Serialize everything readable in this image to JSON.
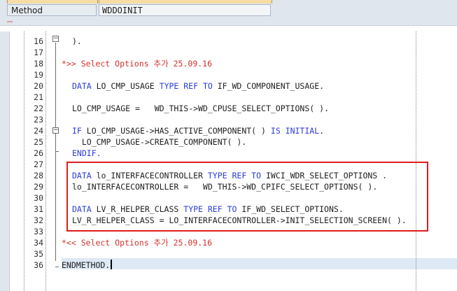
{
  "header": {
    "label": "Method",
    "value": "WDDOINIT"
  },
  "editor": {
    "lines": [
      {
        "num": "16",
        "text": ")."
      },
      {
        "num": "17",
        "text": ""
      },
      {
        "num": "18",
        "text": "*>> Select Options 추가 25.09.16"
      },
      {
        "num": "19",
        "text": ""
      },
      {
        "num": "20",
        "kw1": "DATA",
        "p1": " LO_CMP_USAGE ",
        "kw2": "TYPE REF TO",
        "p2": " IF_WD_COMPONENT_USAGE."
      },
      {
        "num": "21",
        "text": ""
      },
      {
        "num": "22",
        "text": "LO_CMP_USAGE =   WD_THIS->WD_CPUSE_SELECT_OPTIONS( )."
      },
      {
        "num": "23",
        "text": ""
      },
      {
        "num": "24",
        "kw1": "IF",
        "p1": " LO_CMP_USAGE->HAS_ACTIVE_COMPONENT( ) ",
        "kw2": "IS INITIAL",
        "p2": "."
      },
      {
        "num": "25",
        "text": "  LO_CMP_USAGE->CREATE_COMPONENT( )."
      },
      {
        "num": "26",
        "text": "ENDIF."
      },
      {
        "num": "27",
        "text": ""
      },
      {
        "num": "28",
        "kw1": "DATA",
        "p1": " lo_INTERFACECONTROLLER ",
        "kw2": "TYPE REF TO",
        "p2": " IWCI_WDR_SELECT_OPTIONS ."
      },
      {
        "num": "29",
        "text": "lo_INTERFACECONTROLLER =   WD_THIS->WD_CPIFC_SELECT_OPTIONS( )."
      },
      {
        "num": "30",
        "text": ""
      },
      {
        "num": "31",
        "kw1": "DATA",
        "p1": " LV_R_HELPER_CLASS ",
        "kw2": "TYPE REF TO",
        "p2": " IF_WD_SELECT_OPTIONS."
      },
      {
        "num": "32",
        "text": "LV_R_HELPER_CLASS = LO_INTERFACECONTROLLER->INIT_SELECTION_SCREEN( )."
      },
      {
        "num": "33",
        "text": ""
      },
      {
        "num": "34",
        "text": "*<< Select Options 추가 25.09.16"
      },
      {
        "num": "35",
        "text": ""
      },
      {
        "num": "36",
        "text": "ENDMETHOD."
      }
    ]
  },
  "colors": {
    "keyword": "#2b3bd6",
    "comment": "#d1322f",
    "highlight_border": "#e01b1b"
  }
}
